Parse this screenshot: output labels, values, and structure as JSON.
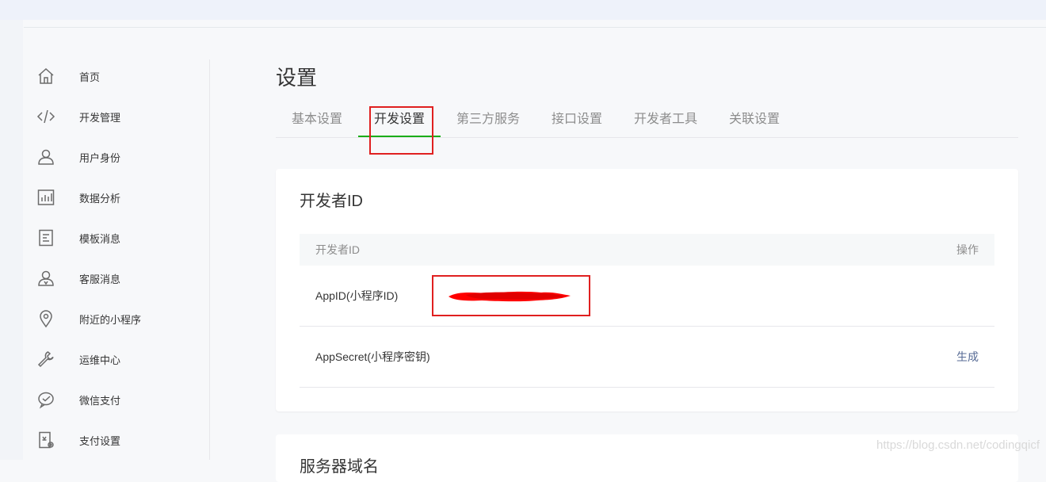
{
  "sidebar": {
    "items": [
      {
        "label": "首页",
        "icon": "home-icon"
      },
      {
        "label": "开发管理",
        "icon": "code-icon"
      },
      {
        "label": "用户身份",
        "icon": "user-icon"
      },
      {
        "label": "数据分析",
        "icon": "bar-chart-icon"
      },
      {
        "label": "模板消息",
        "icon": "document-icon"
      },
      {
        "label": "客服消息",
        "icon": "customer-service-icon"
      },
      {
        "label": "附近的小程序",
        "icon": "location-pin-icon"
      },
      {
        "label": "运维中心",
        "icon": "wrench-icon"
      },
      {
        "label": "微信支付",
        "icon": "wechat-pay-icon"
      },
      {
        "label": "支付设置",
        "icon": "payment-settings-icon"
      }
    ]
  },
  "page": {
    "title": "设置"
  },
  "tabs": [
    {
      "label": "基本设置",
      "active": false
    },
    {
      "label": "开发设置",
      "active": true
    },
    {
      "label": "第三方服务",
      "active": false
    },
    {
      "label": "接口设置",
      "active": false
    },
    {
      "label": "开发者工具",
      "active": false
    },
    {
      "label": "关联设置",
      "active": false
    }
  ],
  "developer_card": {
    "title": "开发者ID",
    "header": {
      "col1": "开发者ID",
      "col2": "操作"
    },
    "rows": [
      {
        "label": "AppID(小程序ID)",
        "value": "",
        "action": ""
      },
      {
        "label": "AppSecret(小程序密钥)",
        "action": "生成"
      }
    ]
  },
  "next_card": {
    "title": "服务器域名"
  },
  "watermark": "https://blog.csdn.net/codingqicf",
  "colors": {
    "accent_green": "#1aad19",
    "link_blue": "#576b95",
    "annotation_red": "#e02020"
  }
}
